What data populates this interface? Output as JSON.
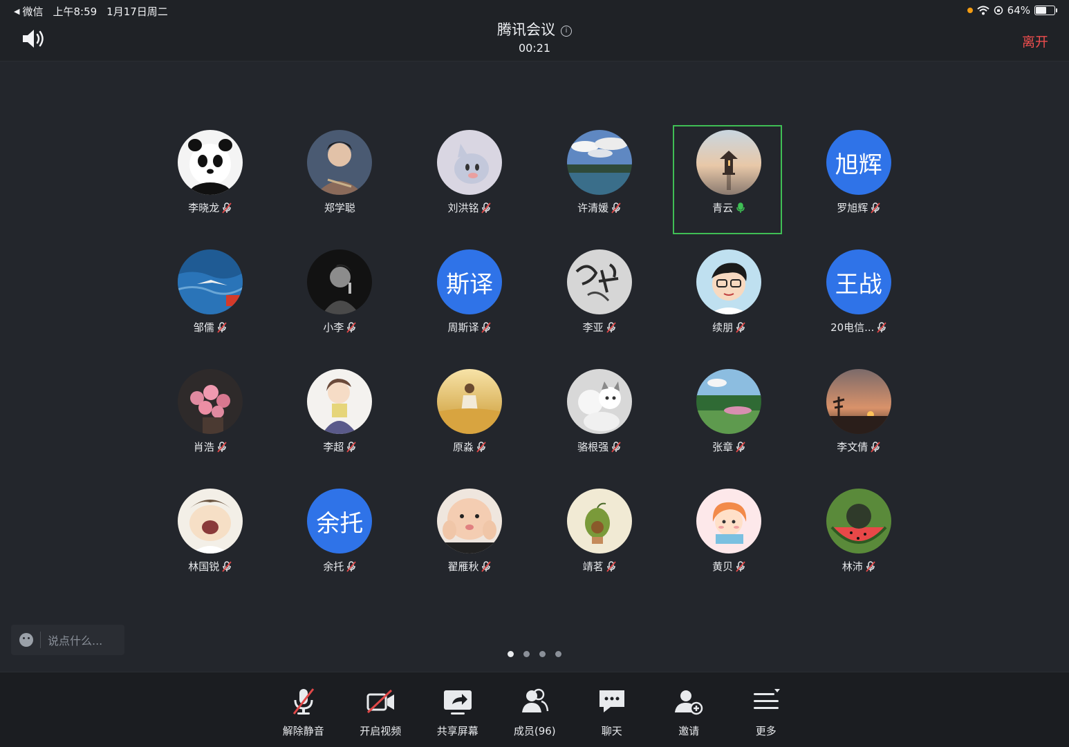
{
  "status_bar": {
    "back_app": "微信",
    "time": "上午8:59",
    "date": "1月17日周二",
    "battery": "64%",
    "battery_level": 0.64
  },
  "header": {
    "title": "腾讯会议",
    "timer": "00:21",
    "leave_label": "离开"
  },
  "participants": [
    {
      "name": "李晓龙",
      "avatar": "panda",
      "mic": "muted"
    },
    {
      "name": "郑学聪",
      "avatar": "photo-person",
      "mic": "none"
    },
    {
      "name": "刘洪铭",
      "avatar": "cartoon-cat",
      "mic": "muted"
    },
    {
      "name": "许清媛",
      "avatar": "landscape-sky",
      "mic": "muted"
    },
    {
      "name": "青云",
      "avatar": "lake-pavilion",
      "mic": "active",
      "active": true
    },
    {
      "name": "罗旭辉",
      "avatar_text": "旭辉",
      "mic": "muted"
    },
    {
      "name": "邹儒",
      "avatar": "ocean-bird",
      "mic": "muted"
    },
    {
      "name": "小李",
      "avatar": "bw-singer",
      "mic": "muted"
    },
    {
      "name": "周斯译",
      "avatar_text": "斯译",
      "mic": "muted"
    },
    {
      "name": "李亚",
      "avatar": "ink-calligraphy",
      "mic": "muted"
    },
    {
      "name": "续朋",
      "avatar": "cartoon-glasses",
      "mic": "muted"
    },
    {
      "name": "20电信...",
      "avatar_text": "王战",
      "mic": "muted"
    },
    {
      "name": "肖浩",
      "avatar": "roses",
      "mic": "muted"
    },
    {
      "name": "李超",
      "avatar": "anime-reader",
      "mic": "muted"
    },
    {
      "name": "原淼",
      "avatar": "wheat-field",
      "mic": "muted"
    },
    {
      "name": "骆根强",
      "avatar": "kittens",
      "mic": "muted"
    },
    {
      "name": "张章",
      "avatar": "garden-lake",
      "mic": "muted"
    },
    {
      "name": "李文倩",
      "avatar": "sunset",
      "mic": "muted"
    },
    {
      "name": "林国锐",
      "avatar": "cartoon-yawn",
      "mic": "muted"
    },
    {
      "name": "余托",
      "avatar_text": "余托",
      "mic": "muted"
    },
    {
      "name": "翟雁秋",
      "avatar": "baby-face",
      "mic": "muted"
    },
    {
      "name": "靖茗",
      "avatar": "avocado",
      "mic": "muted"
    },
    {
      "name": "黄贝",
      "avatar": "cartoon-girl",
      "mic": "muted"
    },
    {
      "name": "林沛",
      "avatar": "watermelon",
      "mic": "muted"
    }
  ],
  "chat": {
    "placeholder": "说点什么..."
  },
  "pagination": {
    "count": 4,
    "current": 1
  },
  "toolbar": [
    {
      "label": "解除静音",
      "icon": "mic-off-icon"
    },
    {
      "label": "开启视频",
      "icon": "camera-off-icon"
    },
    {
      "label": "共享屏幕",
      "icon": "share-screen-icon"
    },
    {
      "label": "成员(96)",
      "icon": "members-icon"
    },
    {
      "label": "聊天",
      "icon": "chat-icon"
    },
    {
      "label": "邀请",
      "icon": "invite-icon"
    },
    {
      "label": "更多",
      "icon": "more-icon"
    }
  ],
  "colors": {
    "leave": "#ef4e4e",
    "active_speaker": "#3fbf55",
    "text_avatar": "#2f73e8",
    "mute_red": "#e04848"
  }
}
